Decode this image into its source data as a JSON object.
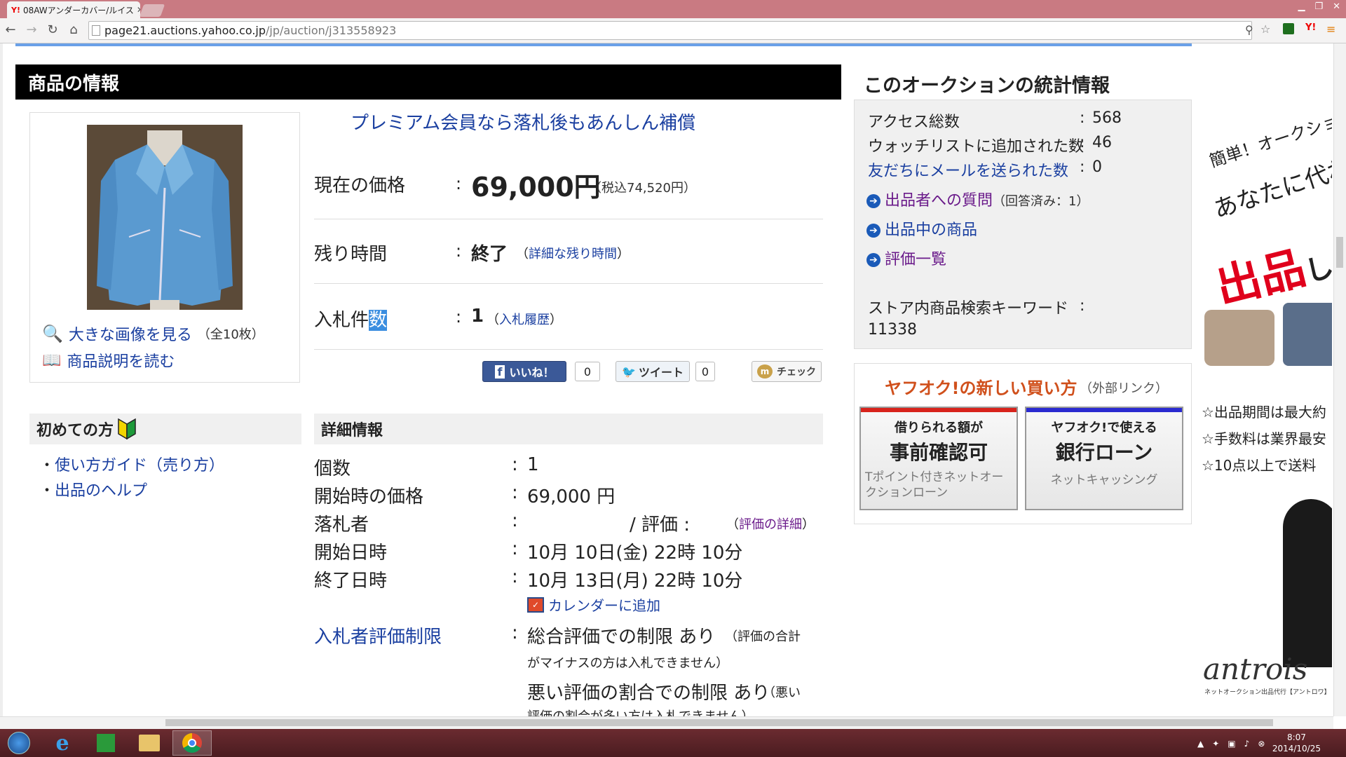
{
  "browser": {
    "tab_title": "08AWアンダーカバー/ルイス",
    "url_host": "page21.auctions.yahoo.co.jp",
    "url_path": "/jp/auction/j313558923"
  },
  "product_section": {
    "header": "商品の情報",
    "premium_link": "プレミアム会員なら落札後もあんしん補償",
    "view_large": "大きな画像を見る",
    "image_count": "（全10枚）",
    "read_desc": "商品説明を読む",
    "price_label": "現在の価格",
    "price_value": "69,000円",
    "price_tax": "（税込74,520円）",
    "time_label": "残り時間",
    "time_value": "終了",
    "time_detail": "詳細な残り時間",
    "bids_label_a": "入札件",
    "bids_label_b": "数",
    "bids_value": "1",
    "bids_history": "入札履歴",
    "like_label": "いいね！",
    "like_count": "0",
    "tweet_label": "ツイート",
    "tweet_count": "0",
    "check_label": "チェック"
  },
  "beginners": {
    "title": "初めての方",
    "guide": "使い方ガイド（売り方）",
    "help": "出品のヘルプ"
  },
  "details": {
    "title": "詳細情報",
    "qty_label": "個数",
    "qty_value": "1",
    "start_price_label": "開始時の価格",
    "start_price_value": "69,000 円",
    "winner_label": "落札者",
    "winner_rating": "/ 評価 :",
    "rating_detail": "評価の詳細",
    "start_label": "開始日時",
    "start_value": "10月 10日(金) 22時 10分",
    "end_label": "終了日時",
    "end_value": "10月 13日(月) 22時 10分",
    "calendar": "カレンダーに追加",
    "restrict_label": "入札者評価制限",
    "restrict1": "総合評価での制限 あり",
    "restrict1_note_a": "（評価の合計",
    "restrict1_note_b": "がマイナスの方は入札できません）",
    "restrict2": "悪い評価の割合での制限 あり",
    "restrict2_note_a": "（悪い",
    "restrict2_note_b": "評価の割合が多い方は入札できません）"
  },
  "stats": {
    "title": "このオークションの統計情報",
    "access_label": "アクセス総数",
    "access_value": "568",
    "watch_label": "ウォッチリストに追加された数",
    "watch_value": "46",
    "mail_label": "友だちにメールを送られた数",
    "mail_value": "0",
    "question": "出品者への質問",
    "question_note": "（回答済み：1）",
    "listings": "出品中の商品",
    "ratings": "評価一覧",
    "keyword_label": "ストア内商品検索キーワード",
    "keyword_value": "11338"
  },
  "new_way": {
    "title": "ヤフオク!の新しい買い方",
    "note": "（外部リンク）",
    "card1_top": "借りられる額が",
    "card1_main": "事前確認可",
    "card1_sub": "Tポイント付きネットオークションローン",
    "card1_color": "#d8231c",
    "card2_top": "ヤフオク!で使える",
    "card2_main": "銀行ローン",
    "card2_sub": "ネットキャッシング",
    "card2_color": "#2a2ad0"
  },
  "ad": {
    "line1": "簡単！オークション",
    "line2": "あなたに代わっ",
    "big": "出品",
    "big_tail": "し",
    "bullet1": "☆出品期間は最大約",
    "bullet2": "☆手数料は業界最安",
    "bullet3": "☆10点以上で送料",
    "brand": "antrois",
    "brand_sub": "ネットオークション出品代行【アントロワ】"
  },
  "taskbar": {
    "time": "8:07",
    "date": "2014/10/25"
  }
}
